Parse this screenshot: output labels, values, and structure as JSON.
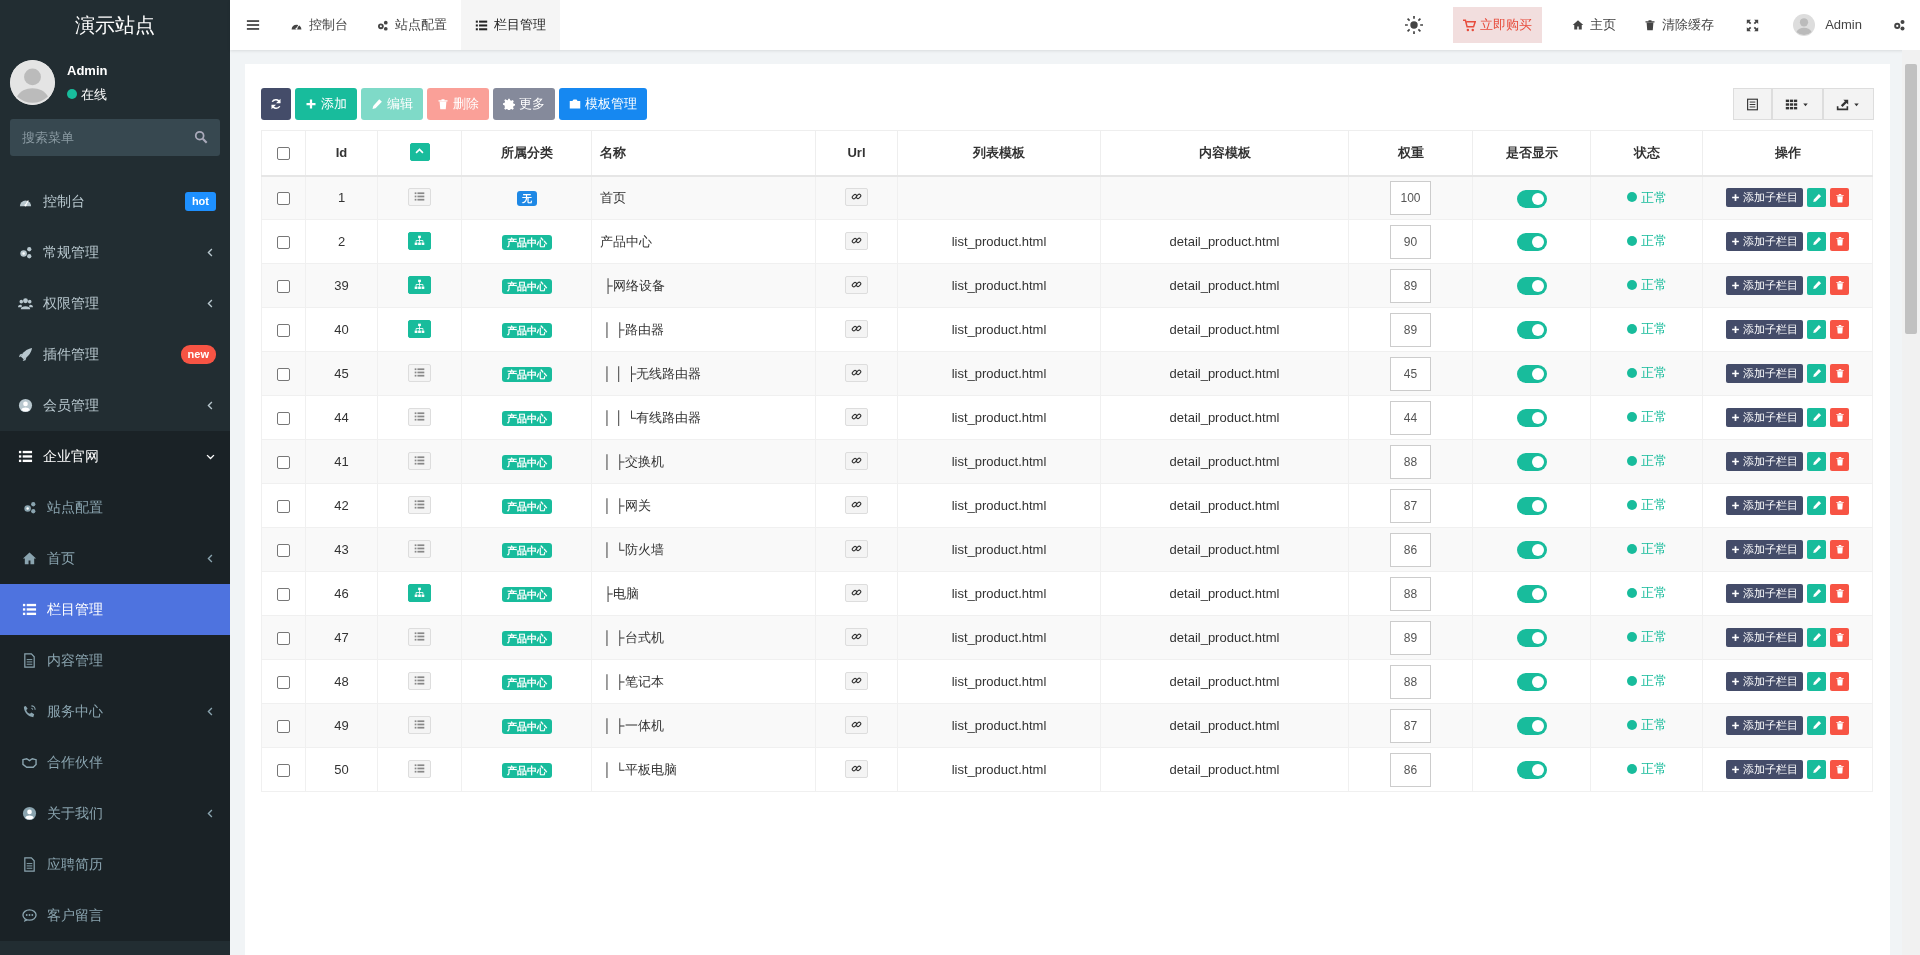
{
  "sidebar": {
    "title": "演示站点",
    "user": {
      "name": "Admin",
      "status": "在线"
    },
    "search": {
      "placeholder": "搜索菜单"
    },
    "items": [
      {
        "label": "控制台",
        "selected": false,
        "badge": {
          "text": "hot",
          "color": "#1e90ff"
        }
      },
      {
        "label": "常规管理",
        "selected": false,
        "expanded": false
      },
      {
        "label": "权限管理",
        "selected": false,
        "expanded": false
      },
      {
        "label": "插件管理",
        "selected": false,
        "badge": {
          "text": "new",
          "color": "#f75444"
        }
      },
      {
        "label": "会员管理",
        "selected": false,
        "expanded": false
      },
      {
        "label": "企业官网",
        "selected": false,
        "expanded": true,
        "children": [
          {
            "label": "站点配置",
            "selected": false
          },
          {
            "label": "首页",
            "selected": false,
            "expanded": false
          },
          {
            "label": "栏目管理",
            "selected": true
          },
          {
            "label": "内容管理",
            "selected": false
          },
          {
            "label": "服务中心",
            "selected": false,
            "expanded": false
          },
          {
            "label": "合作伙伴",
            "selected": false
          },
          {
            "label": "关于我们",
            "selected": false,
            "expanded": false
          },
          {
            "label": "应聘简历",
            "selected": false
          },
          {
            "label": "客户留言",
            "selected": false
          }
        ]
      }
    ]
  },
  "topbar": {
    "tabs": [
      {
        "label": "控制台",
        "selected": false
      },
      {
        "label": "站点配置",
        "selected": false
      },
      {
        "label": "栏目管理",
        "selected": true
      }
    ],
    "buy_button": "立即购买",
    "links": [
      "主页",
      "清除缓存"
    ],
    "user": "Admin"
  },
  "toolbar": {
    "buttons": [
      {
        "disabled": false
      },
      {
        "label": "添加",
        "disabled": false
      },
      {
        "label": "编辑",
        "disabled": true
      },
      {
        "label": "删除",
        "disabled": true
      },
      {
        "label": "更多",
        "disabled": false
      },
      {
        "label": "模板管理",
        "disabled": false
      }
    ]
  },
  "table": {
    "columns": [
      {
        "kind": "checkbox",
        "checked": false
      },
      {
        "kind": "text",
        "label": "Id"
      },
      {
        "kind": "toggle"
      },
      {
        "kind": "text",
        "label": "所属分类"
      },
      {
        "kind": "text",
        "label": "名称"
      },
      {
        "kind": "text",
        "label": "Url"
      },
      {
        "kind": "text",
        "label": "列表模板"
      },
      {
        "kind": "text",
        "label": "内容模板"
      },
      {
        "kind": "text",
        "label": "权重"
      },
      {
        "kind": "text",
        "label": "是否显示"
      },
      {
        "kind": "text",
        "label": "状态"
      },
      {
        "kind": "text",
        "label": "操作"
      }
    ],
    "rows": [
      {
        "checked": false,
        "id": "1",
        "kind": "list",
        "category": {
          "text": "无",
          "color": "#1e88e5"
        },
        "name": "首页",
        "weight": "100",
        "visible": true,
        "status": "正常",
        "action": "添加子栏目"
      },
      {
        "checked": false,
        "id": "2",
        "kind": "tree",
        "category": {
          "text": "产品中心",
          "color": "#18bc9c"
        },
        "name": "产品中心",
        "list_template": "list_product.html",
        "content_template": "detail_product.html",
        "weight": "90",
        "visible": true,
        "status": "正常",
        "action": "添加子栏目"
      },
      {
        "checked": false,
        "id": "39",
        "kind": "tree",
        "category": {
          "text": "产品中心",
          "color": "#18bc9c"
        },
        "name": " ├网络设备",
        "list_template": "list_product.html",
        "content_template": "detail_product.html",
        "weight": "89",
        "visible": true,
        "status": "正常",
        "action": "添加子栏目"
      },
      {
        "checked": false,
        "id": "40",
        "kind": "tree",
        "category": {
          "text": "产品中心",
          "color": "#18bc9c"
        },
        "name": " │ ├路由器",
        "list_template": "list_product.html",
        "content_template": "detail_product.html",
        "weight": "89",
        "visible": true,
        "status": "正常",
        "action": "添加子栏目"
      },
      {
        "checked": false,
        "id": "45",
        "kind": "list",
        "category": {
          "text": "产品中心",
          "color": "#18bc9c"
        },
        "name": " │ │ ├无线路由器",
        "list_template": "list_product.html",
        "content_template": "detail_product.html",
        "weight": "45",
        "visible": true,
        "status": "正常",
        "action": "添加子栏目"
      },
      {
        "checked": false,
        "id": "44",
        "kind": "list",
        "category": {
          "text": "产品中心",
          "color": "#18bc9c"
        },
        "name": " │ │ └有线路由器",
        "list_template": "list_product.html",
        "content_template": "detail_product.html",
        "weight": "44",
        "visible": true,
        "status": "正常",
        "action": "添加子栏目"
      },
      {
        "checked": false,
        "id": "41",
        "kind": "list",
        "category": {
          "text": "产品中心",
          "color": "#18bc9c"
        },
        "name": " │ ├交换机",
        "list_template": "list_product.html",
        "content_template": "detail_product.html",
        "weight": "88",
        "visible": true,
        "status": "正常",
        "action": "添加子栏目"
      },
      {
        "checked": false,
        "id": "42",
        "kind": "list",
        "category": {
          "text": "产品中心",
          "color": "#18bc9c"
        },
        "name": " │ ├网关",
        "list_template": "list_product.html",
        "content_template": "detail_product.html",
        "weight": "87",
        "visible": true,
        "status": "正常",
        "action": "添加子栏目"
      },
      {
        "checked": false,
        "id": "43",
        "kind": "list",
        "category": {
          "text": "产品中心",
          "color": "#18bc9c"
        },
        "name": " │ └防火墙",
        "list_template": "list_product.html",
        "content_template": "detail_product.html",
        "weight": "86",
        "visible": true,
        "status": "正常",
        "action": "添加子栏目"
      },
      {
        "checked": false,
        "id": "46",
        "kind": "tree",
        "category": {
          "text": "产品中心",
          "color": "#18bc9c"
        },
        "name": " ├电脑",
        "list_template": "list_product.html",
        "content_template": "detail_product.html",
        "weight": "88",
        "visible": true,
        "status": "正常",
        "action": "添加子栏目"
      },
      {
        "checked": false,
        "id": "47",
        "kind": "list",
        "category": {
          "text": "产品中心",
          "color": "#18bc9c"
        },
        "name": " │ ├台式机",
        "list_template": "list_product.html",
        "content_template": "detail_product.html",
        "weight": "89",
        "visible": true,
        "status": "正常",
        "action": "添加子栏目"
      },
      {
        "checked": false,
        "id": "48",
        "kind": "list",
        "category": {
          "text": "产品中心",
          "color": "#18bc9c"
        },
        "name": " │ ├笔记本",
        "list_template": "list_product.html",
        "content_template": "detail_product.html",
        "weight": "88",
        "visible": true,
        "status": "正常",
        "action": "添加子栏目"
      },
      {
        "checked": false,
        "id": "49",
        "kind": "list",
        "category": {
          "text": "产品中心",
          "color": "#18bc9c"
        },
        "name": " │ ├一体机",
        "list_template": "list_product.html",
        "content_template": "detail_product.html",
        "weight": "87",
        "visible": true,
        "status": "正常",
        "action": "添加子栏目"
      },
      {
        "checked": false,
        "id": "50",
        "kind": "list",
        "category": {
          "text": "产品中心",
          "color": "#18bc9c"
        },
        "name": " │ └平板电脑",
        "list_template": "list_product.html",
        "content_template": "detail_product.html",
        "weight": "86",
        "visible": true,
        "status": "正常",
        "action": "添加子栏目"
      }
    ]
  }
}
